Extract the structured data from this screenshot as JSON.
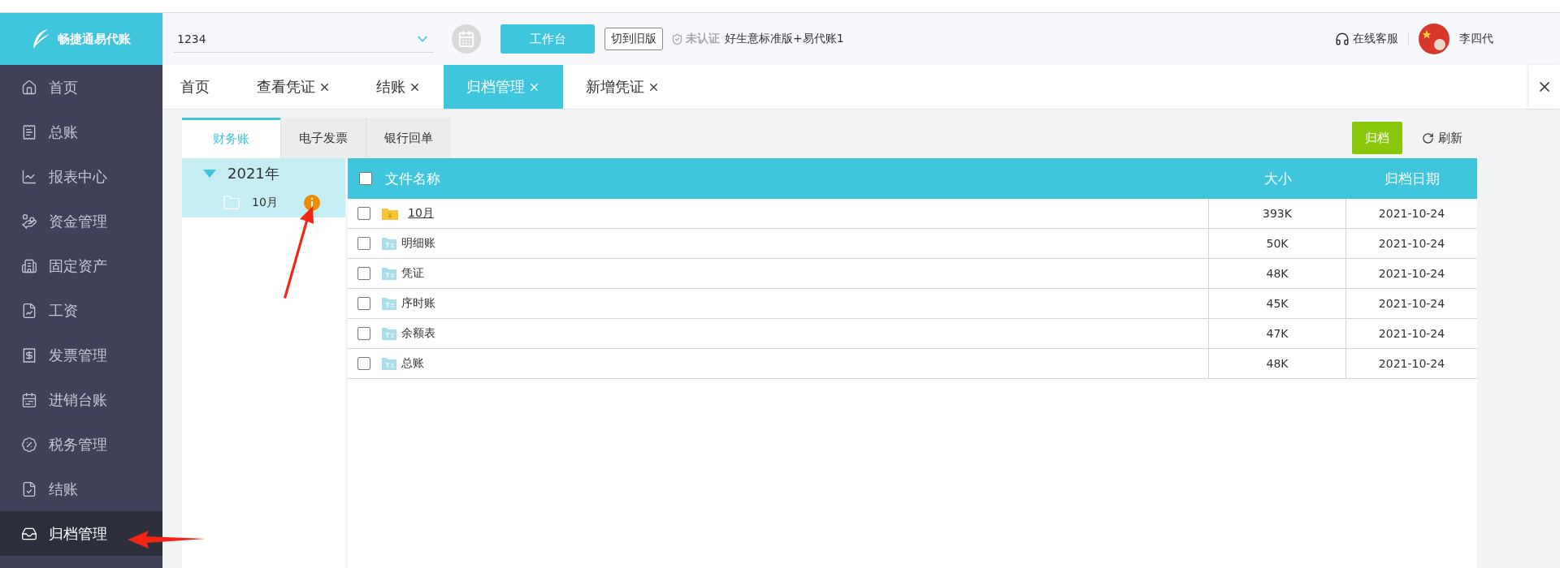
{
  "header": {
    "logo_text": "畅捷通易代账",
    "company_field": {
      "value": "1234"
    },
    "workbench_button": "工作台",
    "old_version_button": "切到旧版",
    "certification": "未认证",
    "product": "好生意标准版+易代账1",
    "support": "在线客服",
    "user_name": "李四代"
  },
  "sidebar": {
    "items": [
      {
        "label": "首页",
        "selected": false
      },
      {
        "label": "总账",
        "selected": false
      },
      {
        "label": "报表中心",
        "selected": false
      },
      {
        "label": "资金管理",
        "selected": false
      },
      {
        "label": "固定资产",
        "selected": false
      },
      {
        "label": "工资",
        "selected": false
      },
      {
        "label": "发票管理",
        "selected": false
      },
      {
        "label": "进销台账",
        "selected": false
      },
      {
        "label": "税务管理",
        "selected": false
      },
      {
        "label": "结账",
        "selected": false
      },
      {
        "label": "归档管理",
        "selected": true
      }
    ]
  },
  "tabs": [
    {
      "label": "首页",
      "selected": false,
      "closable": false
    },
    {
      "label": "查看凭证",
      "selected": false,
      "closable": true
    },
    {
      "label": "结账",
      "selected": false,
      "closable": true
    },
    {
      "label": "归档管理",
      "selected": true,
      "closable": true
    },
    {
      "label": "新增凭证",
      "selected": false,
      "closable": true
    }
  ],
  "subtabs": [
    {
      "label": "财务账",
      "selected": true
    },
    {
      "label": "电子发票",
      "selected": false
    },
    {
      "label": "银行回单",
      "selected": false
    }
  ],
  "actions": {
    "archive_button": "归档",
    "refresh_button": "刷新"
  },
  "tree": [
    {
      "label": "2021年",
      "expanded": true,
      "children": [
        {
          "label": "10月",
          "info": true
        }
      ]
    }
  ],
  "table": {
    "columns": [
      "文件名称",
      "大小",
      "归档日期"
    ],
    "header_checked": false,
    "rows": [
      {
        "kind": "folder",
        "name": "10月",
        "size": "393K",
        "date": "2021-10-24",
        "checked": false
      },
      {
        "kind": "file",
        "name": "明细账",
        "size": "50K",
        "date": "2021-10-24",
        "checked": false
      },
      {
        "kind": "file",
        "name": "凭证",
        "size": "48K",
        "date": "2021-10-24",
        "checked": false
      },
      {
        "kind": "file",
        "name": "序时账",
        "size": "45K",
        "date": "2021-10-24",
        "checked": false
      },
      {
        "kind": "file",
        "name": "余额表",
        "size": "47K",
        "date": "2021-10-24",
        "checked": false
      },
      {
        "kind": "file",
        "name": "总账",
        "size": "48K",
        "date": "2021-10-24",
        "checked": false
      }
    ]
  }
}
